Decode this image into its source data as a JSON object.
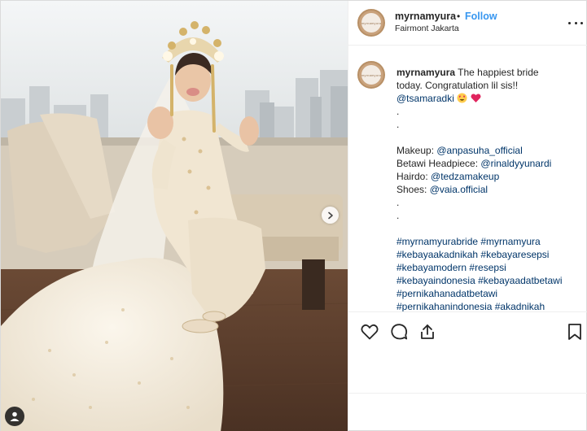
{
  "post": {
    "username": "myrnamyura",
    "separator": "•",
    "follow_label": "Follow",
    "location": "Fairmont Jakarta",
    "avatar_text": "myrnamyura",
    "caption": {
      "username": "myrnamyura",
      "text_1": " The happiest bride",
      "text_2": "today. Congratulation lil sis!!",
      "mention": "@tsamaradki",
      "dot": ".",
      "makeup_label": "Makeup: ",
      "makeup_handle": "@anpasuha_official",
      "headpiece_label": "Betawi Headpiece: ",
      "headpiece_handle": "@rinaldyyunardi",
      "hairdo_label": "Hairdo: ",
      "hairdo_handle": "@tedzamakeup",
      "shoes_label": "Shoes: ",
      "shoes_handle": "@vaia.official",
      "hashtags": [
        "#myrnamyurabride #myrnamyura",
        "#kebayaakadnikah #kebayaresepsi",
        "#kebayamodern #resepsi",
        "#kebayaindonesia #kebayaadatbetawi",
        "#pernikahanadatbetawi",
        "#pernikahanindonesia #akadnikah"
      ]
    }
  },
  "icons": {
    "like": "heart-icon",
    "comment": "comment-icon",
    "share": "share-icon",
    "save": "bookmark-icon",
    "more": "more-options-icon",
    "next": "chevron-right-icon",
    "tagged": "user-tag-icon"
  },
  "colors": {
    "link": "#003569",
    "follow": "#3897f0",
    "border": "#dbdbdb"
  }
}
